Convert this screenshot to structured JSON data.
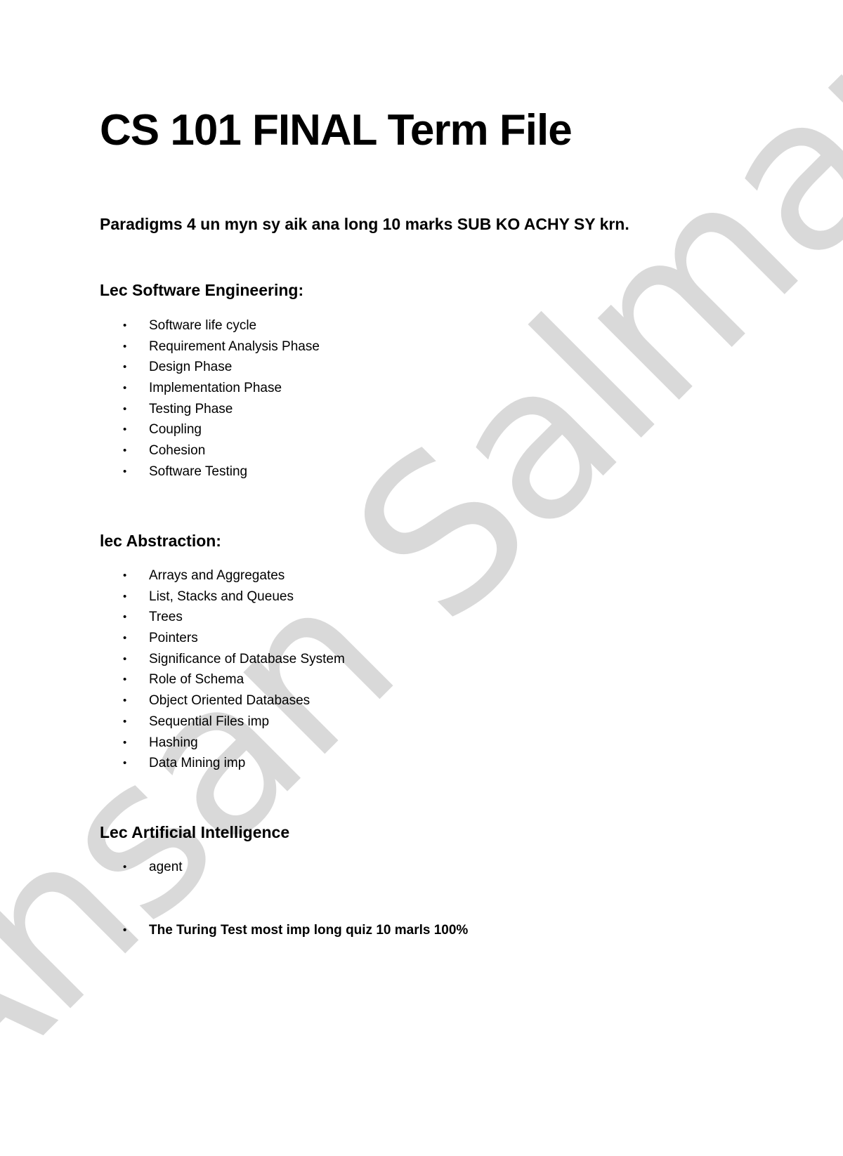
{
  "watermark": "Ahsan Salman",
  "title": "CS 101 FINAL Term File",
  "intro": "Paradigms 4 un myn sy aik ana long 10 marks SUB KO ACHY SY krn.",
  "sections": [
    {
      "heading": "Lec Software Engineering:",
      "items": [
        "Software life cycle",
        "Requirement Analysis Phase",
        "Design Phase",
        "Implementation Phase",
        "Testing Phase",
        "Coupling",
        "Cohesion",
        "Software Testing"
      ]
    },
    {
      "heading": "lec Abstraction:",
      "items": [
        "Arrays and Aggregates",
        "List, Stacks and Queues",
        "Trees",
        "Pointers",
        "Significance of Database System",
        "Role of Schema",
        "Object Oriented Databases",
        "Sequential Files imp",
        "Hashing",
        "Data Mining imp"
      ]
    },
    {
      "heading": "Lec Artificial Intelligence",
      "items": [
        "agent",
        "The Turing Test most imp long quiz 10 marls 100%"
      ]
    }
  ],
  "bullet_glyph": "•"
}
